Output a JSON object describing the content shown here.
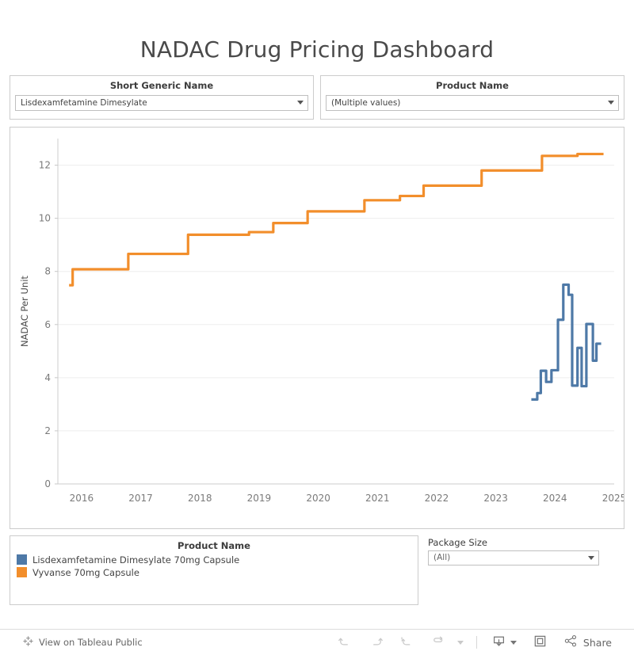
{
  "dashboard": {
    "title": "NADAC Drug Pricing Dashboard"
  },
  "filters": {
    "short_generic_name": {
      "label": "Short Generic Name",
      "value": "Lisdexamfetamine Dimesylate",
      "caret": "chevron-down-icon"
    },
    "product_name": {
      "label": "Product Name",
      "value": "(Multiple values)",
      "caret": "chevron-down-icon"
    },
    "package_size": {
      "label": "Package Size",
      "value": "(All)",
      "caret": "chevron-down-icon"
    }
  },
  "legend": {
    "title": "Product Name",
    "items": [
      {
        "label": "Lisdexamfetamine Dimesylate 70mg Capsule",
        "color": "#4E79A7"
      },
      {
        "label": "Vyvanse 70mg Capsule",
        "color": "#F28E2B"
      }
    ]
  },
  "toolbar": {
    "view_label": "View on Tableau Public",
    "view_icon": "tableau-logo-icon",
    "undo_icon": "undo-icon",
    "redo_icon": "redo-icon",
    "revert_icon": "revert-icon",
    "refresh_icon": "refresh-icon",
    "refresh_caret_icon": "chevron-down-icon",
    "download_icon": "download-icon",
    "download_caret_icon": "chevron-down-icon",
    "fullscreen_icon": "fullscreen-icon",
    "share_icon": "share-icon",
    "share_label": "Share"
  },
  "chart_data": {
    "type": "line",
    "title": "",
    "xlabel": "",
    "ylabel": "NADAC Per Unit",
    "xlim": [
      2015.6,
      2025.0
    ],
    "ylim": [
      0,
      13
    ],
    "yticks": [
      0,
      2,
      4,
      6,
      8,
      10,
      12
    ],
    "xticks": [
      2016,
      2017,
      2018,
      2019,
      2020,
      2021,
      2022,
      2023,
      2024,
      2025
    ],
    "ytick_labels": [
      "0",
      "2",
      "4",
      "6",
      "8",
      "10",
      "12"
    ],
    "xtick_labels": [
      "2016",
      "2017",
      "2018",
      "2019",
      "2020",
      "2021",
      "2022",
      "2023",
      "2024",
      "2025"
    ],
    "grid": "horizontal",
    "legend_position": "bottom",
    "step_style": "post",
    "series": [
      {
        "name": "Vyvanse 70mg Capsule",
        "color": "#F28E2B",
        "points": [
          [
            2015.79,
            7.48
          ],
          [
            2015.85,
            8.08
          ],
          [
            2016.73,
            8.08
          ],
          [
            2016.79,
            8.66
          ],
          [
            2017.74,
            8.66
          ],
          [
            2017.8,
            9.38
          ],
          [
            2018.77,
            9.38
          ],
          [
            2018.83,
            9.48
          ],
          [
            2019.18,
            9.48
          ],
          [
            2019.24,
            9.82
          ],
          [
            2019.76,
            9.82
          ],
          [
            2019.82,
            10.26
          ],
          [
            2020.72,
            10.26
          ],
          [
            2020.78,
            10.68
          ],
          [
            2021.32,
            10.68
          ],
          [
            2021.38,
            10.84
          ],
          [
            2021.72,
            10.84
          ],
          [
            2021.78,
            11.23
          ],
          [
            2022.7,
            11.23
          ],
          [
            2022.76,
            11.8
          ],
          [
            2023.72,
            11.8
          ],
          [
            2023.78,
            12.35
          ],
          [
            2024.32,
            12.35
          ],
          [
            2024.38,
            12.42
          ],
          [
            2024.82,
            12.42
          ]
        ]
      },
      {
        "name": "Lisdexamfetamine Dimesylate 70mg Capsule",
        "color": "#4E79A7",
        "points": [
          [
            2023.6,
            3.18
          ],
          [
            2023.68,
            3.18
          ],
          [
            2023.7,
            3.42
          ],
          [
            2023.74,
            3.42
          ],
          [
            2023.76,
            4.26
          ],
          [
            2023.83,
            4.26
          ],
          [
            2023.85,
            3.84
          ],
          [
            2023.92,
            3.84
          ],
          [
            2023.94,
            4.28
          ],
          [
            2024.03,
            4.28
          ],
          [
            2024.05,
            6.18
          ],
          [
            2024.12,
            6.18
          ],
          [
            2024.14,
            7.5
          ],
          [
            2024.21,
            7.5
          ],
          [
            2024.23,
            7.12
          ],
          [
            2024.27,
            7.12
          ],
          [
            2024.29,
            3.7
          ],
          [
            2024.36,
            3.7
          ],
          [
            2024.38,
            5.12
          ],
          [
            2024.43,
            5.12
          ],
          [
            2024.45,
            3.68
          ],
          [
            2024.51,
            3.68
          ],
          [
            2024.53,
            6.02
          ],
          [
            2024.62,
            6.02
          ],
          [
            2024.64,
            4.64
          ],
          [
            2024.68,
            4.64
          ],
          [
            2024.7,
            5.28
          ],
          [
            2024.78,
            5.28
          ]
        ]
      }
    ]
  }
}
